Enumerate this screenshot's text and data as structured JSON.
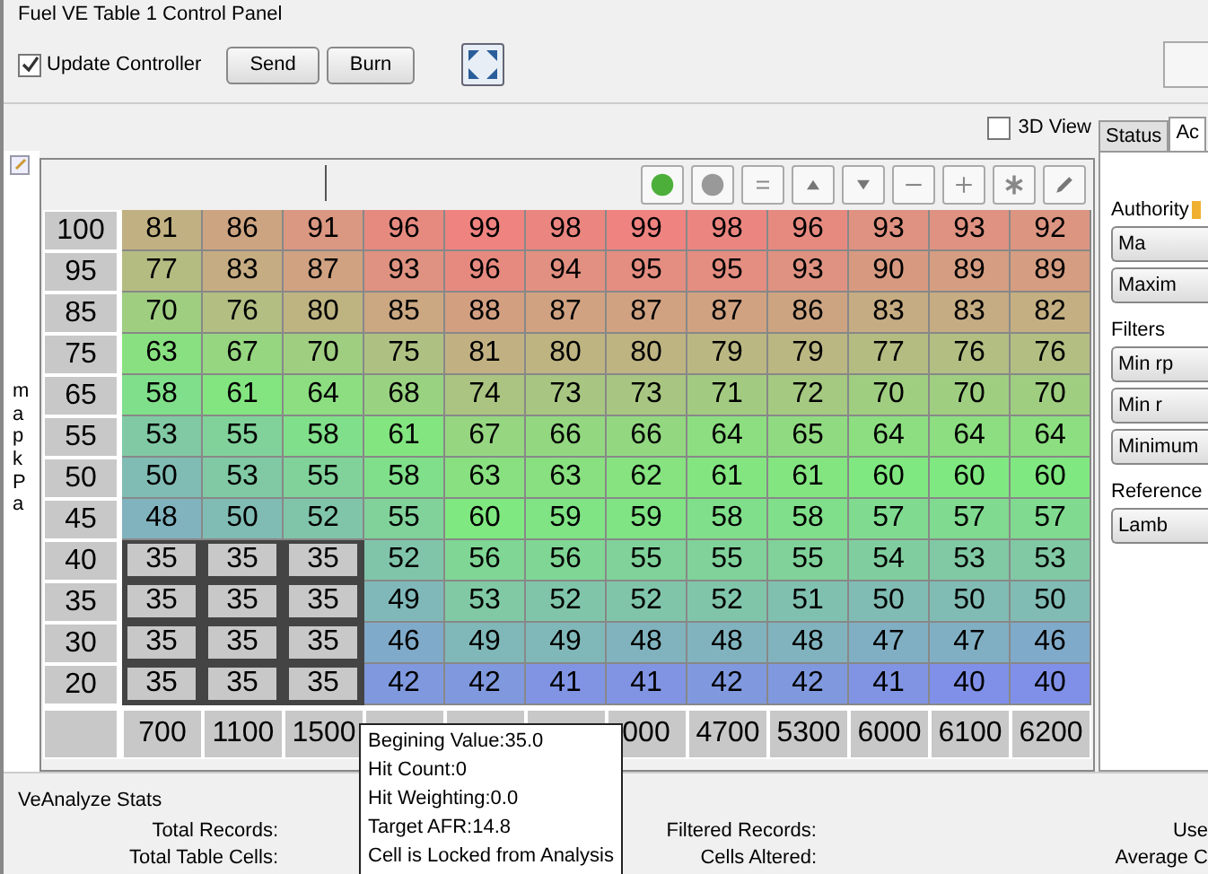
{
  "panel": {
    "title": "Fuel VE Table 1 Control Panel"
  },
  "controls": {
    "update_controller": {
      "label": "Update Controller",
      "checked": true
    },
    "buttons": [
      "Send",
      "Burn"
    ]
  },
  "view_3d": {
    "label": "3D View",
    "checked": false
  },
  "side_tabs": [
    {
      "label": "Status",
      "selected": false
    },
    {
      "label": "Ac",
      "selected": true
    }
  ],
  "side_panel": {
    "sections": [
      {
        "title": "Authority",
        "buttons": [
          "Ma",
          "Maxim"
        ]
      },
      {
        "title": "Filters",
        "buttons": [
          "Min rp",
          "Min r",
          "Minimum"
        ]
      },
      {
        "title": "Reference",
        "buttons": [
          "Lamb"
        ]
      }
    ]
  },
  "table": {
    "y_axis_title": "map kPa",
    "rows": [
      {
        "label": "100",
        "cells": [
          {
            "value": "81",
            "locked": false
          },
          {
            "value": "86",
            "locked": false
          },
          {
            "value": "91",
            "locked": false
          },
          {
            "value": "96",
            "locked": false
          },
          {
            "value": "99",
            "locked": false
          },
          {
            "value": "98",
            "locked": false
          },
          {
            "value": "99",
            "locked": false
          },
          {
            "value": "98",
            "locked": false
          },
          {
            "value": "96",
            "locked": false
          },
          {
            "value": "93",
            "locked": false
          },
          {
            "value": "93",
            "locked": false
          },
          {
            "value": "92",
            "locked": false
          }
        ]
      },
      {
        "label": "95",
        "cells": [
          {
            "value": "77",
            "locked": false
          },
          {
            "value": "83",
            "locked": false
          },
          {
            "value": "87",
            "locked": false
          },
          {
            "value": "93",
            "locked": false
          },
          {
            "value": "96",
            "locked": false
          },
          {
            "value": "94",
            "locked": false
          },
          {
            "value": "95",
            "locked": false
          },
          {
            "value": "95",
            "locked": false
          },
          {
            "value": "93",
            "locked": false
          },
          {
            "value": "90",
            "locked": false
          },
          {
            "value": "89",
            "locked": false
          },
          {
            "value": "89",
            "locked": false
          }
        ]
      },
      {
        "label": "85",
        "cells": [
          {
            "value": "70",
            "locked": false
          },
          {
            "value": "76",
            "locked": false
          },
          {
            "value": "80",
            "locked": false
          },
          {
            "value": "85",
            "locked": false
          },
          {
            "value": "88",
            "locked": false
          },
          {
            "value": "87",
            "locked": false
          },
          {
            "value": "87",
            "locked": false
          },
          {
            "value": "87",
            "locked": false
          },
          {
            "value": "86",
            "locked": false
          },
          {
            "value": "83",
            "locked": false
          },
          {
            "value": "83",
            "locked": false
          },
          {
            "value": "82",
            "locked": false
          }
        ]
      },
      {
        "label": "75",
        "cells": [
          {
            "value": "63",
            "locked": false
          },
          {
            "value": "67",
            "locked": false
          },
          {
            "value": "70",
            "locked": false
          },
          {
            "value": "75",
            "locked": false
          },
          {
            "value": "81",
            "locked": false
          },
          {
            "value": "80",
            "locked": false
          },
          {
            "value": "80",
            "locked": false
          },
          {
            "value": "79",
            "locked": false
          },
          {
            "value": "79",
            "locked": false
          },
          {
            "value": "77",
            "locked": false
          },
          {
            "value": "76",
            "locked": false
          },
          {
            "value": "76",
            "locked": false
          }
        ]
      },
      {
        "label": "65",
        "cells": [
          {
            "value": "58",
            "locked": false
          },
          {
            "value": "61",
            "locked": false
          },
          {
            "value": "64",
            "locked": false
          },
          {
            "value": "68",
            "locked": false
          },
          {
            "value": "74",
            "locked": false
          },
          {
            "value": "73",
            "locked": false
          },
          {
            "value": "73",
            "locked": false
          },
          {
            "value": "71",
            "locked": false
          },
          {
            "value": "72",
            "locked": false
          },
          {
            "value": "70",
            "locked": false
          },
          {
            "value": "70",
            "locked": false
          },
          {
            "value": "70",
            "locked": false
          }
        ]
      },
      {
        "label": "55",
        "cells": [
          {
            "value": "53",
            "locked": false
          },
          {
            "value": "55",
            "locked": false
          },
          {
            "value": "58",
            "locked": false
          },
          {
            "value": "61",
            "locked": false
          },
          {
            "value": "67",
            "locked": false
          },
          {
            "value": "66",
            "locked": false
          },
          {
            "value": "66",
            "locked": false
          },
          {
            "value": "64",
            "locked": false
          },
          {
            "value": "65",
            "locked": false
          },
          {
            "value": "64",
            "locked": false
          },
          {
            "value": "64",
            "locked": false
          },
          {
            "value": "64",
            "locked": false
          }
        ]
      },
      {
        "label": "50",
        "cells": [
          {
            "value": "50",
            "locked": false
          },
          {
            "value": "53",
            "locked": false
          },
          {
            "value": "55",
            "locked": false
          },
          {
            "value": "58",
            "locked": false
          },
          {
            "value": "63",
            "locked": false
          },
          {
            "value": "63",
            "locked": false
          },
          {
            "value": "62",
            "locked": false
          },
          {
            "value": "61",
            "locked": false
          },
          {
            "value": "61",
            "locked": false
          },
          {
            "value": "60",
            "locked": false
          },
          {
            "value": "60",
            "locked": false
          },
          {
            "value": "60",
            "locked": false
          }
        ]
      },
      {
        "label": "45",
        "cells": [
          {
            "value": "48",
            "locked": false
          },
          {
            "value": "50",
            "locked": false
          },
          {
            "value": "52",
            "locked": false
          },
          {
            "value": "55",
            "locked": false
          },
          {
            "value": "60",
            "locked": false
          },
          {
            "value": "59",
            "locked": false
          },
          {
            "value": "59",
            "locked": false
          },
          {
            "value": "58",
            "locked": false
          },
          {
            "value": "58",
            "locked": false
          },
          {
            "value": "57",
            "locked": false
          },
          {
            "value": "57",
            "locked": false
          },
          {
            "value": "57",
            "locked": false
          }
        ]
      },
      {
        "label": "40",
        "cells": [
          {
            "value": "35",
            "locked": true
          },
          {
            "value": "35",
            "locked": true
          },
          {
            "value": "35",
            "locked": true
          },
          {
            "value": "52",
            "locked": false
          },
          {
            "value": "56",
            "locked": false
          },
          {
            "value": "56",
            "locked": false
          },
          {
            "value": "55",
            "locked": false
          },
          {
            "value": "55",
            "locked": false
          },
          {
            "value": "55",
            "locked": false
          },
          {
            "value": "54",
            "locked": false
          },
          {
            "value": "53",
            "locked": false
          },
          {
            "value": "53",
            "locked": false
          }
        ]
      },
      {
        "label": "35",
        "cells": [
          {
            "value": "35",
            "locked": true
          },
          {
            "value": "35",
            "locked": true
          },
          {
            "value": "35",
            "locked": true
          },
          {
            "value": "49",
            "locked": false
          },
          {
            "value": "53",
            "locked": false
          },
          {
            "value": "52",
            "locked": false
          },
          {
            "value": "52",
            "locked": false
          },
          {
            "value": "52",
            "locked": false
          },
          {
            "value": "51",
            "locked": false
          },
          {
            "value": "50",
            "locked": false
          },
          {
            "value": "50",
            "locked": false
          },
          {
            "value": "50",
            "locked": false
          }
        ]
      },
      {
        "label": "30",
        "cells": [
          {
            "value": "35",
            "locked": true
          },
          {
            "value": "35",
            "locked": true
          },
          {
            "value": "35",
            "locked": true
          },
          {
            "value": "46",
            "locked": false
          },
          {
            "value": "49",
            "locked": false
          },
          {
            "value": "49",
            "locked": false
          },
          {
            "value": "48",
            "locked": false
          },
          {
            "value": "48",
            "locked": false
          },
          {
            "value": "48",
            "locked": false
          },
          {
            "value": "47",
            "locked": false
          },
          {
            "value": "47",
            "locked": false
          },
          {
            "value": "46",
            "locked": false
          }
        ]
      },
      {
        "label": "20",
        "cells": [
          {
            "value": "35",
            "locked": true
          },
          {
            "value": "35",
            "locked": true
          },
          {
            "value": "35",
            "locked": true
          },
          {
            "value": "42",
            "locked": false
          },
          {
            "value": "42",
            "locked": false
          },
          {
            "value": "41",
            "locked": false
          },
          {
            "value": "41",
            "locked": false
          },
          {
            "value": "42",
            "locked": false
          },
          {
            "value": "42",
            "locked": false
          },
          {
            "value": "41",
            "locked": false
          },
          {
            "value": "40",
            "locked": false
          },
          {
            "value": "40",
            "locked": false
          }
        ]
      }
    ],
    "x_axis": [
      {
        "label": "700",
        "covered": false
      },
      {
        "label": "1100",
        "covered": false
      },
      {
        "label": "1500",
        "covered": false
      },
      {
        "covered": true
      },
      {
        "covered": true
      },
      {
        "covered": true
      },
      {
        "label": "000",
        "covered": false
      },
      {
        "label": "4700",
        "covered": false
      },
      {
        "label": "5300",
        "covered": false
      },
      {
        "label": "6000",
        "covered": false
      },
      {
        "label": "6100",
        "covered": false
      },
      {
        "label": "6200",
        "covered": false
      }
    ]
  },
  "tooltip": [
    "Begining Value:35.0",
    "Hit Count:0",
    "Hit Weighting:0.0",
    "Target AFR:14.8",
    "Cell is Locked from Analysis"
  ],
  "stats": {
    "title": "VeAnalyze Stats",
    "rows": [
      [
        "Total Records:",
        "Filtered Records:",
        "Use"
      ],
      [
        "Total Table Cells:",
        "Cells Altered:",
        "Average C"
      ]
    ]
  }
}
